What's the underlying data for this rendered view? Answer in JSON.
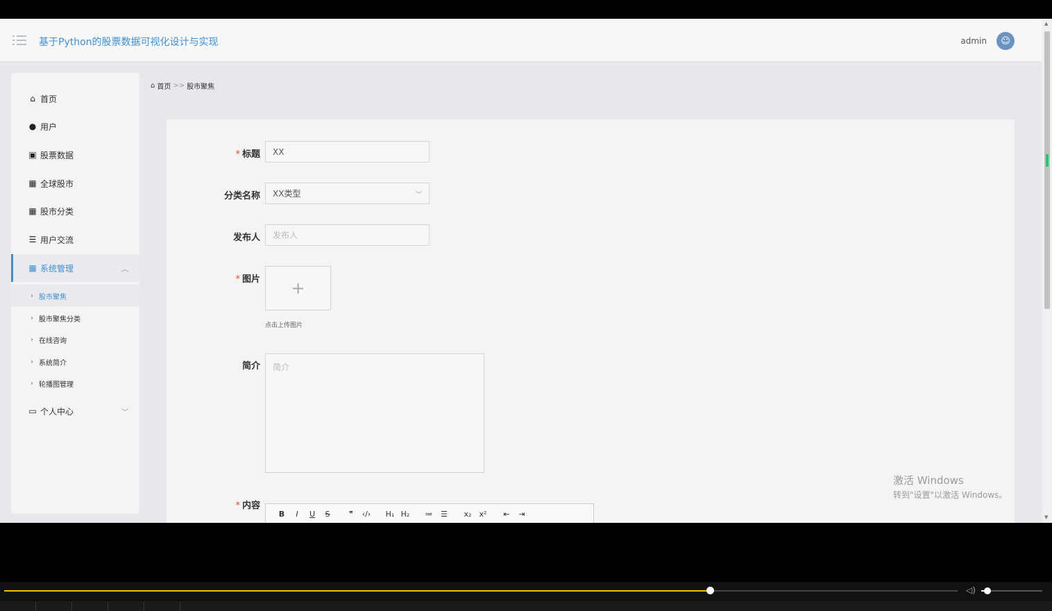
{
  "header": {
    "title": "基于Python的股票数据可视化设计与实现",
    "user": "admin"
  },
  "sidebar": {
    "items": [
      {
        "label": "首页",
        "icon": "home-icon"
      },
      {
        "label": "用户",
        "icon": "bulb-icon"
      },
      {
        "label": "股票数据",
        "icon": "clipboard-icon"
      },
      {
        "label": "全球股市",
        "icon": "grid-icon"
      },
      {
        "label": "股市分类",
        "icon": "grid-icon"
      },
      {
        "label": "用户交流",
        "icon": "list-icon"
      },
      {
        "label": "系统管理",
        "icon": "grid-icon",
        "expanded": true
      },
      {
        "label": "个人中心",
        "icon": "card-icon"
      }
    ],
    "subitems": [
      "股市聚焦",
      "股市聚焦分类",
      "在线咨询",
      "系统简介",
      "轮播图管理"
    ]
  },
  "breadcrumb": {
    "home": "首页",
    "sep": ">>",
    "current": "股市聚焦"
  },
  "form": {
    "title_label": "标题",
    "title_value": "XX",
    "category_label": "分类名称",
    "category_value": "XX类型",
    "publisher_label": "发布人",
    "publisher_placeholder": "发布人",
    "image_label": "图片",
    "upload_plus": "+",
    "upload_hint": "点击上传图片",
    "intro_label": "简介",
    "intro_placeholder": "简介",
    "content_label": "内容",
    "required_mark": "*"
  },
  "editor_toolbar": [
    "B",
    "I",
    "U",
    "S",
    "❞",
    "‹/›",
    "H₁",
    "H₂",
    "≔",
    "☰",
    "x₂",
    "x²",
    "⇤",
    "⇥"
  ],
  "watermark": {
    "line1": "激活 Windows",
    "line2": "转到\"设置\"以激活 Windows。"
  },
  "player": {
    "progress": 0.74,
    "volume": 0.1
  }
}
